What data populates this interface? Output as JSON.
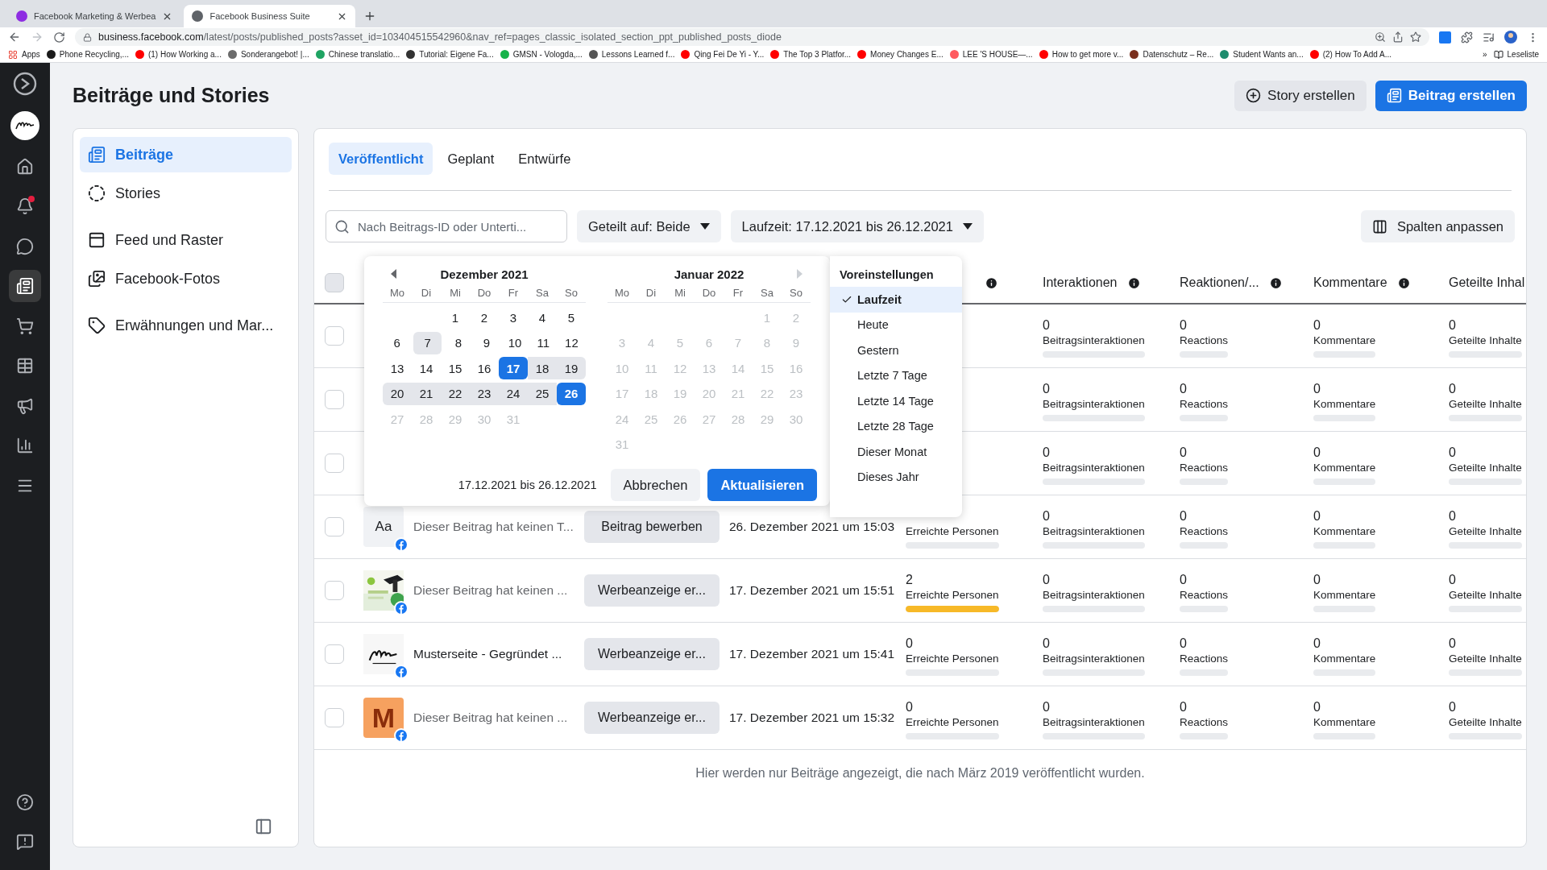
{
  "browser": {
    "tabs": [
      {
        "title": "Facebook Marketing & Werbea",
        "selected": false,
        "color": "#8e2de2"
      },
      {
        "title": "Facebook Business Suite",
        "selected": true,
        "color": "#5f6368"
      }
    ],
    "url_host": "business.facebook.com",
    "url_path": "/latest/posts/published_posts?asset_id=103404515542960&nav_ref=pages_classic_isolated_section_ppt_published_posts_diode",
    "apps": "Apps",
    "bookmarks": [
      {
        "label": "Phone Recycling,...",
        "color": "#1a1a1a"
      },
      {
        "label": "(1) How Working a...",
        "color": "#ff0000"
      },
      {
        "label": "Sonderangebot! |...",
        "color": "#6b6b6b"
      },
      {
        "label": "Chinese translatio...",
        "color": "#1fa463"
      },
      {
        "label": "Tutorial: Eigene Fa...",
        "color": "#333333"
      },
      {
        "label": "GMSN - Vologda,...",
        "color": "#17b34a"
      },
      {
        "label": "Lessons Learned f...",
        "color": "#555555"
      },
      {
        "label": "Qing Fei De Yi - Y...",
        "color": "#ff0000"
      },
      {
        "label": "The Top 3 Platfor...",
        "color": "#ff0000"
      },
      {
        "label": "Money Changes E...",
        "color": "#ff0000"
      },
      {
        "label": "LEE 'S HOUSE—...",
        "color": "#ff5a5f"
      },
      {
        "label": "How to get more v...",
        "color": "#ff0000"
      },
      {
        "label": "Datenschutz – Re...",
        "color": "#7a2f1d"
      },
      {
        "label": "Student Wants an...",
        "color": "#1e8c6e"
      },
      {
        "label": "(2) How To Add A...",
        "color": "#ff0000"
      }
    ],
    "more": "»",
    "reading_list": "Leseliste"
  },
  "rail": {
    "items": [
      {
        "kind": "home",
        "selected": false,
        "badge": false
      },
      {
        "kind": "notifications",
        "selected": false,
        "badge": true
      },
      {
        "kind": "inbox",
        "selected": false,
        "badge": false
      },
      {
        "kind": "posts",
        "selected": true,
        "badge": false
      },
      {
        "kind": "commerce",
        "selected": false,
        "badge": false
      },
      {
        "kind": "planner",
        "selected": false,
        "badge": false
      },
      {
        "kind": "ads",
        "selected": false,
        "badge": false
      },
      {
        "kind": "insights",
        "selected": false,
        "badge": false
      },
      {
        "kind": "more",
        "selected": false,
        "badge": false
      }
    ],
    "bottom": [
      {
        "kind": "help"
      },
      {
        "kind": "feedback"
      }
    ]
  },
  "title": "Beiträge und Stories",
  "actions": [
    {
      "label": "Story erstellen",
      "kind": "secondary"
    },
    {
      "label": "Beitrag erstellen",
      "kind": "primary"
    }
  ],
  "nav": [
    {
      "items": [
        {
          "label": "Beiträge",
          "kind": "posts",
          "selected": true
        },
        {
          "label": "Stories",
          "kind": "stories",
          "selected": false
        }
      ]
    },
    {
      "items": [
        {
          "label": "Feed und Raster",
          "kind": "feed",
          "selected": false
        },
        {
          "label": "Facebook-Fotos",
          "kind": "photos",
          "selected": false
        }
      ]
    },
    {
      "items": [
        {
          "label": "Erwähnungen und Mar...",
          "kind": "mentions",
          "selected": false
        }
      ]
    }
  ],
  "tabs": [
    {
      "label": "Veröffentlicht",
      "selected": true
    },
    {
      "label": "Geplant",
      "selected": false
    },
    {
      "label": "Entwürfe",
      "selected": false
    }
  ],
  "filters": {
    "search_placeholder": "Nach Beitrags-ID oder Unterti...",
    "shared_on": "Geteilt auf: Beide",
    "period": "Laufzeit: 17.12.2021 bis 26.12.2021",
    "columns": "Spalten anpassen"
  },
  "table": {
    "select_all": {
      "checked": false
    },
    "metric_columns": [
      {
        "info": true
      },
      {
        "label": "Interaktionen",
        "info": true
      },
      {
        "label": "Reaktionen/...",
        "info": true
      },
      {
        "label": "Kommentare",
        "info": true
      },
      {
        "label": "Geteilte Inhal"
      }
    ],
    "rows": [
      {
        "checked": false,
        "metrics": [
          {
            "value": "0",
            "label": "Beitragsinteraktionen",
            "level": 0
          },
          {
            "value": "0",
            "label": "Reactions",
            "level": 0
          },
          {
            "value": "0",
            "label": "Kommentare",
            "level": 0
          },
          {
            "value": "0",
            "label": "Geteilte Inhalte",
            "level": 0
          }
        ]
      },
      {
        "checked": false,
        "metrics": [
          {
            "value": "0",
            "label": "Beitragsinteraktionen",
            "level": 0
          },
          {
            "value": "0",
            "label": "Reactions",
            "level": 0
          },
          {
            "value": "0",
            "label": "Kommentare",
            "level": 0
          },
          {
            "value": "0",
            "label": "Geteilte Inhalte",
            "level": 0
          }
        ]
      },
      {
        "checked": false,
        "metrics": [
          {
            "value": "0",
            "label": "Beitragsinteraktionen",
            "level": 0
          },
          {
            "value": "0",
            "label": "Reactions",
            "level": 0
          },
          {
            "value": "0",
            "label": "Kommentare",
            "level": 0
          },
          {
            "value": "0",
            "label": "Geteilte Inhalte",
            "level": 0
          }
        ]
      },
      {
        "checked": false,
        "post": {
          "thumb": {
            "kind": "text",
            "text": "Aa"
          },
          "caption": "Dieser Beitrag hat keinen T...",
          "muted": true,
          "action": "Beitrag bewerben",
          "date": "26. Dezember 2021 um 15:03"
        },
        "reach": {
          "label": "Erreichte Personen",
          "level": 0
        },
        "metrics": [
          {
            "value": "0",
            "label": "Beitragsinteraktionen",
            "level": 0
          },
          {
            "value": "0",
            "label": "Reactions",
            "level": 0
          },
          {
            "value": "0",
            "label": "Kommentare",
            "level": 0
          },
          {
            "value": "0",
            "label": "Geteilte Inhalte",
            "level": 0
          }
        ]
      },
      {
        "checked": false,
        "post": {
          "caption": "Dieser Beitrag hat keinen ...",
          "muted": true,
          "action": "Werbeanzeige er...",
          "date": "17. Dezember 2021 um 15:51"
        },
        "reach": {
          "value": "2",
          "label": "Erreichte Personen",
          "level": 1
        },
        "metrics": [
          {
            "value": "0",
            "label": "Beitragsinteraktionen",
            "level": 0
          },
          {
            "value": "0",
            "label": "Reactions",
            "level": 0
          },
          {
            "value": "0",
            "label": "Kommentare",
            "level": 0
          },
          {
            "value": "0",
            "label": "Geteilte Inhalte",
            "level": 0
          }
        ]
      },
      {
        "checked": false,
        "post": {
          "thumb": {
            "kind": "logo"
          },
          "caption": "Musterseite - Gegründet ...",
          "muted": false,
          "action": "Werbeanzeige er...",
          "date": "17. Dezember 2021 um 15:41"
        },
        "reach": {
          "value": "0",
          "label": "Erreichte Personen",
          "level": 0
        },
        "metrics": [
          {
            "value": "0",
            "label": "Beitragsinteraktionen",
            "level": 0
          },
          {
            "value": "0",
            "label": "Reactions",
            "level": 0
          },
          {
            "value": "0",
            "label": "Kommentare",
            "level": 0
          },
          {
            "value": "0",
            "label": "Geteilte Inhalte",
            "level": 0
          }
        ]
      },
      {
        "checked": false,
        "post": {
          "thumb": {
            "kind": "letter",
            "text": "M"
          },
          "caption": "Dieser Beitrag hat keinen ...",
          "muted": true,
          "action": "Werbeanzeige er...",
          "date": "17. Dezember 2021 um 15:32"
        },
        "reach": {
          "value": "0",
          "label": "Erreichte Personen",
          "level": 0
        },
        "metrics": [
          {
            "value": "0",
            "label": "Beitragsinteraktionen",
            "level": 0
          },
          {
            "value": "0",
            "label": "Reactions",
            "level": 0
          },
          {
            "value": "0",
            "label": "Kommentare",
            "level": 0
          },
          {
            "value": "0",
            "label": "Geteilte Inhalte",
            "level": 0
          }
        ]
      }
    ],
    "note": "Hier werden nur Beiträge angezeigt, die nach März 2019 veröffentlicht wurden."
  },
  "date_picker": {
    "months": [
      {
        "title": "Dezember 2021",
        "arrow_disabled": false,
        "weekdays": [
          "Mo",
          "Di",
          "Mi",
          "Do",
          "Fr",
          "Sa",
          "So"
        ],
        "weeks": [
          [
            {
              "d": "1",
              "kind": "normal"
            },
            {
              "d": "2",
              "kind": "normal"
            },
            {
              "d": "3",
              "kind": "normal"
            },
            {
              "d": "4",
              "kind": "normal"
            },
            {
              "d": "5",
              "kind": "normal"
            }
          ],
          [
            {
              "d": "6",
              "kind": "normal"
            },
            {
              "d": "7",
              "kind": "hover"
            },
            {
              "d": "8",
              "kind": "normal"
            },
            {
              "d": "9",
              "kind": "normal"
            },
            {
              "d": "10",
              "kind": "normal"
            },
            {
              "d": "11",
              "kind": "normal"
            },
            {
              "d": "12",
              "kind": "normal"
            }
          ],
          [
            {
              "d": "13",
              "kind": "normal"
            },
            {
              "d": "14",
              "kind": "normal"
            },
            {
              "d": "15",
              "kind": "normal"
            },
            {
              "d": "16",
              "kind": "normal"
            },
            {
              "d": "17",
              "kind": "start"
            },
            {
              "d": "18",
              "kind": "range"
            },
            {
              "d": "19",
              "kind": "range"
            }
          ],
          [
            {
              "d": "20",
              "kind": "range"
            },
            {
              "d": "21",
              "kind": "range"
            },
            {
              "d": "22",
              "kind": "range"
            },
            {
              "d": "23",
              "kind": "range"
            },
            {
              "d": "24",
              "kind": "range"
            },
            {
              "d": "25",
              "kind": "range"
            },
            {
              "d": "26",
              "kind": "end"
            }
          ],
          [
            {
              "d": "27",
              "kind": "disabled"
            },
            {
              "d": "28",
              "kind": "disabled"
            },
            {
              "d": "29",
              "kind": "disabled"
            },
            {
              "d": "30",
              "kind": "disabled"
            },
            {
              "d": "31",
              "kind": "disabled"
            }
          ]
        ]
      },
      {
        "title": "Januar 2022",
        "arrow_disabled": true,
        "weekdays": [
          "Mo",
          "Di",
          "Mi",
          "Do",
          "Fr",
          "Sa",
          "So"
        ],
        "weeks": [
          [
            {
              "d": "1",
              "kind": "disabled"
            },
            {
              "d": "2",
              "kind": "disabled"
            }
          ],
          [
            {
              "d": "3",
              "kind": "disabled"
            },
            {
              "d": "4",
              "kind": "disabled"
            },
            {
              "d": "5",
              "kind": "disabled"
            },
            {
              "d": "6",
              "kind": "disabled"
            },
            {
              "d": "7",
              "kind": "disabled"
            },
            {
              "d": "8",
              "kind": "disabled"
            },
            {
              "d": "9",
              "kind": "disabled"
            }
          ],
          [
            {
              "d": "10",
              "kind": "disabled"
            },
            {
              "d": "11",
              "kind": "disabled"
            },
            {
              "d": "12",
              "kind": "disabled"
            },
            {
              "d": "13",
              "kind": "disabled"
            },
            {
              "d": "14",
              "kind": "disabled"
            },
            {
              "d": "15",
              "kind": "disabled"
            },
            {
              "d": "16",
              "kind": "disabled"
            }
          ],
          [
            {
              "d": "17",
              "kind": "disabled"
            },
            {
              "d": "18",
              "kind": "disabled"
            },
            {
              "d": "19",
              "kind": "disabled"
            },
            {
              "d": "20",
              "kind": "disabled"
            },
            {
              "d": "21",
              "kind": "disabled"
            },
            {
              "d": "22",
              "kind": "disabled"
            },
            {
              "d": "23",
              "kind": "disabled"
            }
          ],
          [
            {
              "d": "24",
              "kind": "disabled"
            },
            {
              "d": "25",
              "kind": "disabled"
            },
            {
              "d": "26",
              "kind": "disabled"
            },
            {
              "d": "27",
              "kind": "disabled"
            },
            {
              "d": "28",
              "kind": "disabled"
            },
            {
              "d": "29",
              "kind": "disabled"
            },
            {
              "d": "30",
              "kind": "disabled"
            }
          ],
          [
            {
              "d": "31",
              "kind": "disabled"
            }
          ]
        ]
      }
    ],
    "range_label": "17.12.2021 bis 26.12.2021",
    "cancel": "Abbrechen",
    "apply": "Aktualisieren",
    "presets": {
      "title": "Voreinstellungen",
      "items": [
        {
          "label": "Laufzeit",
          "selected": true
        },
        {
          "label": "Heute",
          "selected": false
        },
        {
          "label": "Gestern",
          "selected": false
        },
        {
          "label": "Letzte 7 Tage",
          "selected": false
        },
        {
          "label": "Letzte 14 Tage",
          "selected": false
        },
        {
          "label": "Letzte 28 Tage",
          "selected": false
        },
        {
          "label": "Dieser Monat",
          "selected": false
        },
        {
          "label": "Dieses Jahr",
          "selected": false
        }
      ]
    }
  }
}
